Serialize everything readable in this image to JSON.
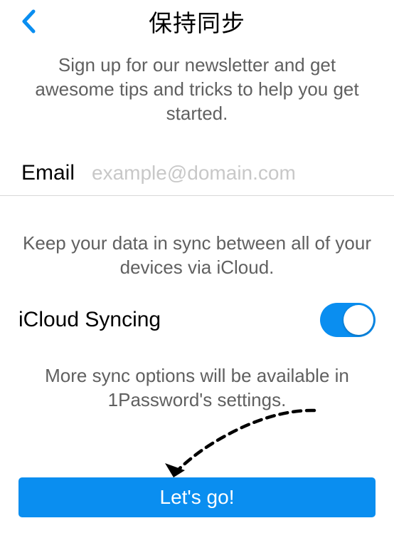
{
  "header": {
    "title": "保持同步"
  },
  "newsletter": {
    "description": "Sign up for our newsletter and get awesome tips and tricks to help you get started.",
    "email_label": "Email",
    "email_placeholder": "example@domain.com",
    "email_value": ""
  },
  "sync": {
    "description": "Keep your data in sync between all of your devices via iCloud.",
    "toggle_label": "iCloud Syncing",
    "toggle_on": true,
    "more_options": "More sync options will be available in 1Password's settings."
  },
  "cta": {
    "go_label": "Let's go!"
  },
  "colors": {
    "accent": "#0a8ef0",
    "text_muted": "#606060",
    "placeholder": "#c8c8c8"
  }
}
